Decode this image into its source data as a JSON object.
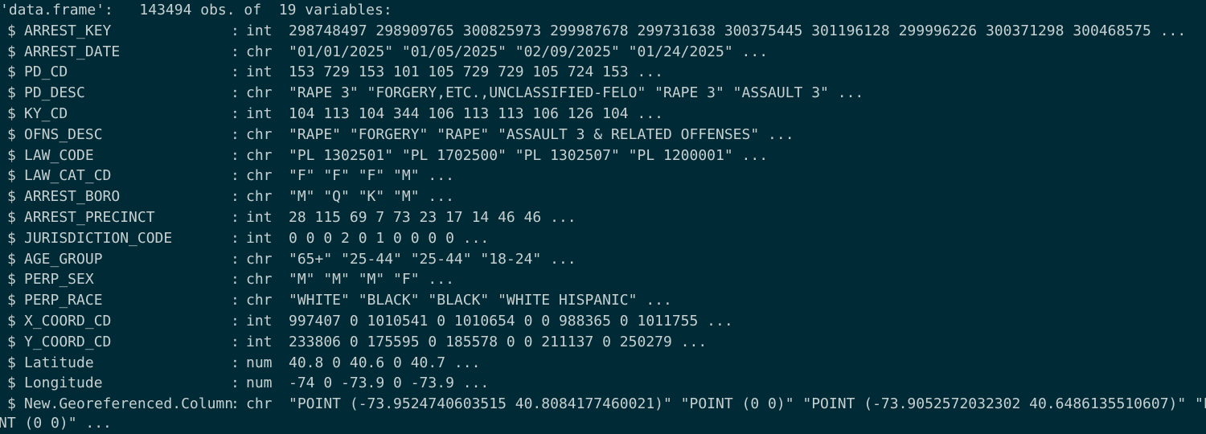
{
  "header": "'data.frame':   143494 obs. of  19 variables:",
  "rows": [
    {
      "prefix": "$",
      "name": "ARREST_KEY",
      "sep": ":",
      "type": "int",
      "values": "298748497 298909765 300825973 299987678 299731638 300375445 301196128 299996226 300371298 300468575 ..."
    },
    {
      "prefix": "$",
      "name": "ARREST_DATE",
      "sep": ":",
      "type": "chr",
      "values": "\"01/01/2025\" \"01/05/2025\" \"02/09/2025\" \"01/24/2025\" ..."
    },
    {
      "prefix": "$",
      "name": "PD_CD",
      "sep": ":",
      "type": "int",
      "values": "153 729 153 101 105 729 729 105 724 153 ..."
    },
    {
      "prefix": "$",
      "name": "PD_DESC",
      "sep": ":",
      "type": "chr",
      "values": "\"RAPE 3\" \"FORGERY,ETC.,UNCLASSIFIED-FELO\" \"RAPE 3\" \"ASSAULT 3\" ..."
    },
    {
      "prefix": "$",
      "name": "KY_CD",
      "sep": ":",
      "type": "int",
      "values": "104 113 104 344 106 113 113 106 126 104 ..."
    },
    {
      "prefix": "$",
      "name": "OFNS_DESC",
      "sep": ":",
      "type": "chr",
      "values": "\"RAPE\" \"FORGERY\" \"RAPE\" \"ASSAULT 3 & RELATED OFFENSES\" ..."
    },
    {
      "prefix": "$",
      "name": "LAW_CODE",
      "sep": ":",
      "type": "chr",
      "values": "\"PL 1302501\" \"PL 1702500\" \"PL 1302507\" \"PL 1200001\" ..."
    },
    {
      "prefix": "$",
      "name": "LAW_CAT_CD",
      "sep": ":",
      "type": "chr",
      "values": "\"F\" \"F\" \"F\" \"M\" ..."
    },
    {
      "prefix": "$",
      "name": "ARREST_BORO",
      "sep": ":",
      "type": "chr",
      "values": "\"M\" \"Q\" \"K\" \"M\" ..."
    },
    {
      "prefix": "$",
      "name": "ARREST_PRECINCT",
      "sep": ":",
      "type": "int",
      "values": "28 115 69 7 73 23 17 14 46 46 ..."
    },
    {
      "prefix": "$",
      "name": "JURISDICTION_CODE",
      "sep": ":",
      "type": "int",
      "values": "0 0 0 2 0 1 0 0 0 0 ..."
    },
    {
      "prefix": "$",
      "name": "AGE_GROUP",
      "sep": ":",
      "type": "chr",
      "values": "\"65+\" \"25-44\" \"25-44\" \"18-24\" ..."
    },
    {
      "prefix": "$",
      "name": "PERP_SEX",
      "sep": ":",
      "type": "chr",
      "values": "\"M\" \"M\" \"M\" \"F\" ..."
    },
    {
      "prefix": "$",
      "name": "PERP_RACE",
      "sep": ":",
      "type": "chr",
      "values": "\"WHITE\" \"BLACK\" \"BLACK\" \"WHITE HISPANIC\" ..."
    },
    {
      "prefix": "$",
      "name": "X_COORD_CD",
      "sep": ":",
      "type": "int",
      "values": "997407 0 1010541 0 1010654 0 0 988365 0 1011755 ..."
    },
    {
      "prefix": "$",
      "name": "Y_COORD_CD",
      "sep": ":",
      "type": "int",
      "values": "233806 0 175595 0 185578 0 0 211137 0 250279 ..."
    },
    {
      "prefix": "$",
      "name": "Latitude",
      "sep": ":",
      "type": "num",
      "values": "40.8 0 40.6 0 40.7 ..."
    },
    {
      "prefix": "$",
      "name": "Longitude",
      "sep": ":",
      "type": "num",
      "values": "-74 0 -73.9 0 -73.9 ..."
    },
    {
      "prefix": "$",
      "name": "New.Georeferenced.Column",
      "sep": ":",
      "type": "chr",
      "values": "\"POINT (-73.9524740603515 40.8084177460021)\" \"POINT (0 0)\" \"POINT (-73.9052572032302 40.6486135510607)\" \"POI"
    }
  ],
  "continuation": "NT (0 0)\" ..."
}
